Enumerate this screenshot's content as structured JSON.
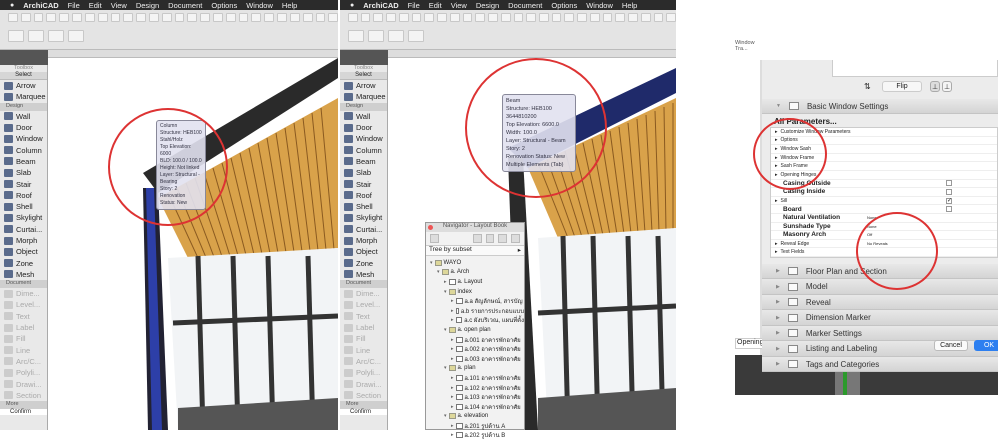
{
  "menubar": {
    "app": "ArchiCAD",
    "items": [
      "File",
      "Edit",
      "View",
      "Design",
      "Document",
      "Options",
      "Window",
      "Help"
    ]
  },
  "toolbox": {
    "title": "Toolbox",
    "select": "Select",
    "design_header": "Design",
    "document_header": "Document",
    "more": "More",
    "select_tools": [
      "Arrow",
      "Marquee"
    ],
    "design_tools": [
      "Wall",
      "Door",
      "Window",
      "Column",
      "Beam",
      "Slab",
      "Stair",
      "Roof",
      "Shell",
      "Skylight",
      "Curtai...",
      "Morph",
      "Object",
      "Zone",
      "Mesh"
    ],
    "document_tools": [
      "Dime...",
      "Level...",
      "Text",
      "Label",
      "Fill",
      "Line",
      "Arc/C...",
      "Polyli...",
      "Drawi...",
      "Section"
    ]
  },
  "status_left": "Confirm",
  "tooltip_column": [
    "Column",
    "Structure: HEB100 Stahl/Holz",
    "Top Elevation: 6000",
    "BLD: 100.0 / 100.0",
    "Height: Not linked",
    "Layer: Structural - Bearing",
    "Story: 2",
    "Renovation Status: New"
  ],
  "tooltip_beam": [
    "Beam",
    "Structure: HEB100 3644810200",
    "Top Elevation: 6600.0",
    "Width: 100.0",
    "Layer: Structural - Beam",
    "Story: 2",
    "Renovation Status: New",
    "Multiple Elements (Tab)"
  ],
  "navigator": {
    "title": "Navigator - Layout Book",
    "selector": "Tree by subset",
    "tree": [
      {
        "d": 0,
        "t": "WAYO",
        "k": "root"
      },
      {
        "d": 1,
        "t": "a. Arch",
        "k": "f"
      },
      {
        "d": 2,
        "t": "a. Layout",
        "k": "p"
      },
      {
        "d": 2,
        "t": "index",
        "k": "f"
      },
      {
        "d": 3,
        "t": "a.a สัญลักษณ์, สารบัญ",
        "k": "p"
      },
      {
        "d": 3,
        "t": "a.b รายการประกอบแบบ",
        "k": "p"
      },
      {
        "d": 3,
        "t": "a.c ผังบริเวณ, แผนที่ตั้ง",
        "k": "p"
      },
      {
        "d": 2,
        "t": "a. open plan",
        "k": "f"
      },
      {
        "d": 3,
        "t": "a.001 อาคารพักอาศัย",
        "k": "p"
      },
      {
        "d": 3,
        "t": "a.002 อาคารพักอาศัย",
        "k": "p"
      },
      {
        "d": 3,
        "t": "a.003 อาคารพักอาศัย",
        "k": "p"
      },
      {
        "d": 2,
        "t": "a. plan",
        "k": "f"
      },
      {
        "d": 3,
        "t": "a.101 อาคารพักอาศัย",
        "k": "p"
      },
      {
        "d": 3,
        "t": "a.102 อาคารพักอาศัย",
        "k": "p"
      },
      {
        "d": 3,
        "t": "a.103 อาคารพักอาศัย",
        "k": "p"
      },
      {
        "d": 3,
        "t": "a.104 อาคารพักอาศัย",
        "k": "p"
      },
      {
        "d": 2,
        "t": "a. elevation",
        "k": "f"
      },
      {
        "d": 3,
        "t": "a.201 รูปด้าน A",
        "k": "p"
      },
      {
        "d": 3,
        "t": "a.202 รูปด้าน B",
        "k": "p"
      }
    ]
  },
  "dialog": {
    "side_label_1": "Window Tra...",
    "side_label_2": "Opening",
    "flip": "Flip",
    "basic": "Basic Window Settings",
    "all_params": "All Parameters...",
    "params": [
      {
        "n": "Customize Window Parameters",
        "t": "s"
      },
      {
        "n": "Options",
        "t": "s"
      },
      {
        "n": "Window Sash",
        "t": "s"
      },
      {
        "n": "Window Frame",
        "t": "s"
      },
      {
        "n": "Sash Frame",
        "t": "s"
      },
      {
        "n": "Opening Hinges",
        "t": "s"
      },
      {
        "n": "Casing Outside",
        "t": "b",
        "cb": ""
      },
      {
        "n": "Casing Inside",
        "t": "b",
        "cb": ""
      },
      {
        "n": "Sill",
        "t": "s",
        "cb": "✓"
      },
      {
        "n": "Board",
        "t": "b",
        "cb": ""
      },
      {
        "n": "Natural Ventilation",
        "t": "b",
        "v": "None"
      },
      {
        "n": "Sunshade Type",
        "t": "b",
        "v": "None"
      },
      {
        "n": "Masonry Arch",
        "t": "b",
        "v": "Off"
      },
      {
        "n": "Reveal Edge",
        "t": "s",
        "v": "No Reveals"
      },
      {
        "n": "Text Fields",
        "t": "s"
      }
    ],
    "sections": [
      "Floor Plan and Section",
      "Model",
      "Reveal",
      "Dimension Marker",
      "Marker Settings",
      "Listing and Labeling",
      "Tags and Categories"
    ],
    "cancel": "Cancel",
    "ok": "OK"
  },
  "colors": {
    "annotation": "#d33333",
    "ok": "#2d7ff0",
    "ceiling": "#d9a24a"
  }
}
